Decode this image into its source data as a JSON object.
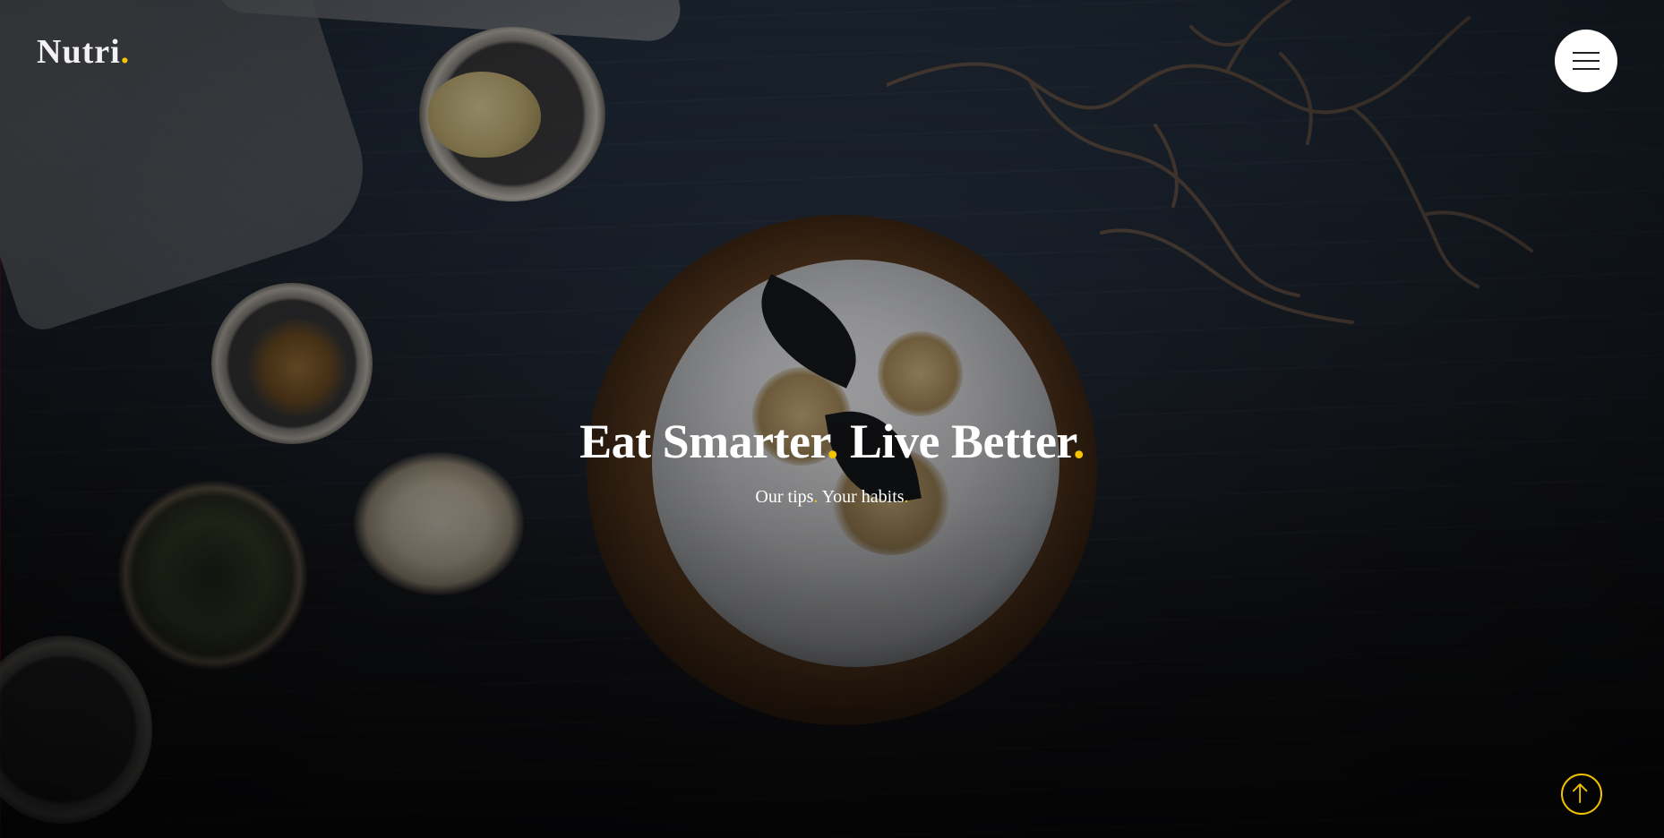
{
  "header": {
    "logo_text": "Nutri",
    "logo_dot": ".",
    "menu_icon": "hamburger-menu-icon"
  },
  "hero": {
    "headline_part1": "Eat Smarter",
    "headline_dot1": ".",
    "headline_part2": " Live Better",
    "headline_dot2": ".",
    "subline_part1": "Our tips",
    "subline_dot1": ".",
    "subline_part2": " Your habits",
    "subline_dot2": "."
  },
  "scroll_top": {
    "icon": "arrow-up-icon"
  },
  "colors": {
    "accent": "#f5c400",
    "text": "#ffffff",
    "menu_button": "#ffffff"
  }
}
